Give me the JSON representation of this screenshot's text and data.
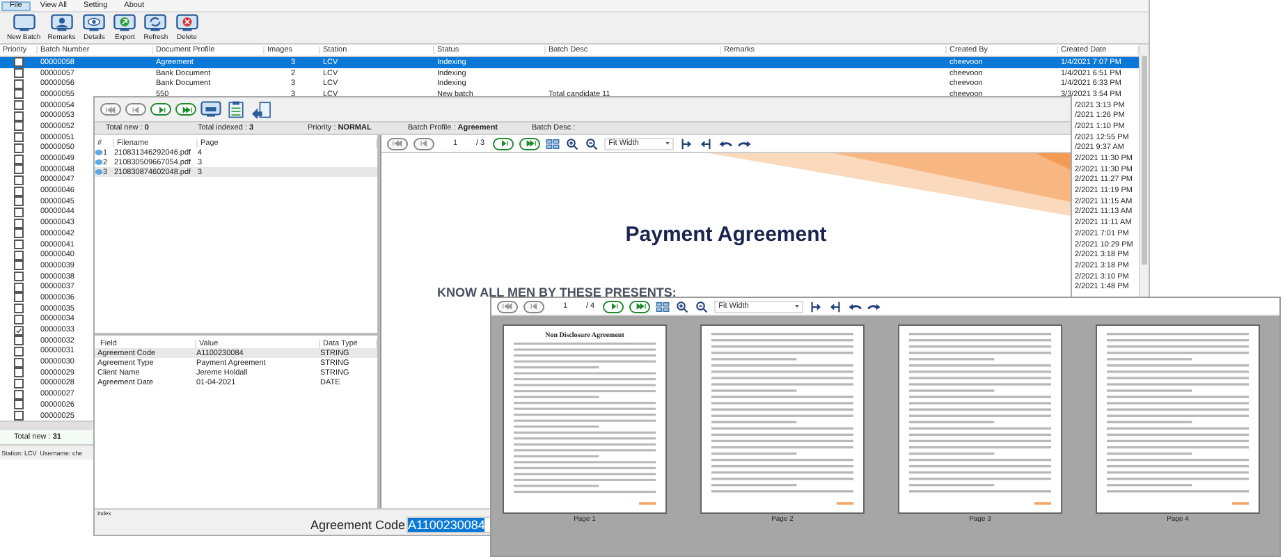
{
  "menu": [
    {
      "label": "File",
      "selected": true
    },
    {
      "label": "View All",
      "selected": false
    },
    {
      "label": "Setting",
      "selected": false
    },
    {
      "label": "About",
      "selected": false
    }
  ],
  "toolbar": [
    {
      "label": "New Batch",
      "kind": "new"
    },
    {
      "label": "Remarks",
      "kind": "remarks"
    },
    {
      "label": "Details",
      "kind": "details"
    },
    {
      "label": "Export",
      "kind": "export"
    },
    {
      "label": "Refresh",
      "kind": "refresh"
    },
    {
      "label": "Delete",
      "kind": "delete"
    }
  ],
  "batch_table": {
    "columns": [
      "Priority",
      "Batch Number",
      "Document Profile",
      "Images",
      "Station",
      "Status",
      "Batch Desc",
      "Remarks",
      "Created By",
      "Created Date"
    ],
    "rows": [
      {
        "kind": "full",
        "selected": true,
        "checked": false,
        "batch_number": "00000058",
        "document_profile": "Agreement",
        "images": "3",
        "station": "LCV",
        "status": "Indexing",
        "created_by": "cheevoon",
        "created_date": "1/4/2021 7:07 PM"
      },
      {
        "kind": "full",
        "selected": false,
        "checked": false,
        "batch_number": "00000057",
        "document_profile": "Bank Document",
        "images": "2",
        "station": "LCV",
        "status": "Indexing",
        "created_by": "cheevoon",
        "created_date": "1/4/2021 6:51 PM"
      },
      {
        "kind": "full",
        "selected": false,
        "checked": false,
        "batch_number": "00000056",
        "document_profile": "Bank Document",
        "images": "3",
        "station": "LCV",
        "status": "Indexing",
        "created_by": "cheevoon",
        "created_date": "1/4/2021 6:33 PM"
      },
      {
        "kind": "full",
        "selected": false,
        "checked": false,
        "batch_number": "00000055",
        "document_profile": "550",
        "images": "3",
        "station": "LCV",
        "status": "New batch",
        "batch_desc": "Total candidate 11",
        "created_by": "cheevoon",
        "created_date": "3/3/2021 3:54 PM"
      },
      {
        "kind": "covered",
        "selected": false,
        "checked": false,
        "batch_number": "00000054",
        "created_date": "/2021 3:13 PM"
      },
      {
        "kind": "covered",
        "selected": false,
        "checked": false,
        "batch_number": "00000053",
        "created_date": "/2021 1:26 PM"
      },
      {
        "kind": "covered",
        "selected": false,
        "checked": false,
        "batch_number": "00000052",
        "created_date": "/2021 1:10 PM"
      },
      {
        "kind": "covered",
        "selected": false,
        "checked": false,
        "batch_number": "00000051",
        "created_date": "/2021 12:55 PM"
      },
      {
        "kind": "covered",
        "selected": false,
        "checked": false,
        "batch_number": "00000050",
        "created_date": "/2021 9:37 AM"
      },
      {
        "kind": "covered",
        "selected": false,
        "checked": false,
        "batch_number": "00000049",
        "created_date": "2/2021 11:30 PM"
      },
      {
        "kind": "covered",
        "selected": false,
        "checked": false,
        "batch_number": "00000048",
        "created_date": "2/2021 11:30 PM"
      },
      {
        "kind": "covered",
        "selected": false,
        "checked": false,
        "batch_number": "00000047",
        "created_date": "2/2021 11:27 PM"
      },
      {
        "kind": "covered",
        "selected": false,
        "checked": false,
        "batch_number": "00000046",
        "created_date": "2/2021 11:19 PM"
      },
      {
        "kind": "covered",
        "selected": false,
        "checked": false,
        "batch_number": "00000045",
        "created_date": "2/2021 11:15 AM"
      },
      {
        "kind": "covered",
        "selected": false,
        "checked": false,
        "batch_number": "00000044",
        "created_date": "2/2021 11:13 AM"
      },
      {
        "kind": "covered",
        "selected": false,
        "checked": false,
        "batch_number": "00000043",
        "created_date": "2/2021 11:11 AM"
      },
      {
        "kind": "covered",
        "selected": false,
        "checked": false,
        "batch_number": "00000042",
        "created_date": "2/2021 7:01 PM"
      },
      {
        "kind": "covered",
        "selected": false,
        "checked": false,
        "batch_number": "00000041",
        "created_date": "2/2021 10:29 PM"
      },
      {
        "kind": "covered",
        "selected": false,
        "checked": false,
        "batch_number": "00000040",
        "created_date": "2/2021 3:18 PM"
      },
      {
        "kind": "covered",
        "selected": false,
        "checked": false,
        "batch_number": "00000039",
        "created_date": "2/2021 3:18 PM"
      },
      {
        "kind": "covered",
        "selected": false,
        "checked": false,
        "batch_number": "00000038",
        "created_date": "2/2021 3:10 PM"
      },
      {
        "kind": "covered",
        "selected": false,
        "checked": false,
        "batch_number": "00000037",
        "created_date": "2/2021 1:48 PM"
      },
      {
        "kind": "covered",
        "selected": false,
        "checked": false,
        "batch_number": "00000036"
      },
      {
        "kind": "covered",
        "selected": false,
        "checked": false,
        "batch_number": "00000035"
      },
      {
        "kind": "covered",
        "selected": false,
        "checked": false,
        "batch_number": "00000034"
      },
      {
        "kind": "covered",
        "selected": false,
        "checked": true,
        "batch_number": "00000033"
      },
      {
        "kind": "covered",
        "selected": false,
        "checked": false,
        "batch_number": "00000032"
      },
      {
        "kind": "covered",
        "selected": false,
        "checked": false,
        "batch_number": "00000031"
      },
      {
        "kind": "covered",
        "selected": false,
        "checked": false,
        "batch_number": "00000030"
      },
      {
        "kind": "covered",
        "selected": false,
        "checked": false,
        "batch_number": "00000029"
      },
      {
        "kind": "covered",
        "selected": false,
        "checked": false,
        "batch_number": "00000028"
      },
      {
        "kind": "covered",
        "selected": false,
        "checked": false,
        "batch_number": "00000027"
      },
      {
        "kind": "covered",
        "selected": false,
        "checked": false,
        "batch_number": "00000026"
      },
      {
        "kind": "covered",
        "selected": false,
        "checked": false,
        "batch_number": "00000025"
      }
    ]
  },
  "total_new": "Total new : **31**",
  "status_bar": "Station: LCV  Username: che",
  "index_window": {
    "nav_buttons": [
      {
        "kind": "first",
        "disabled": true
      },
      {
        "kind": "prev",
        "disabled": true
      },
      {
        "kind": "next",
        "disabled": false
      },
      {
        "kind": "last",
        "disabled": false
      }
    ],
    "info": [
      "Total new : **0**",
      "Total indexed : **3**",
      "Priority : **NORMAL**",
      "Batch Profile : **Agreement**",
      "Batch Desc :"
    ],
    "files": {
      "columns": [
        "#",
        "Filename",
        "Page"
      ],
      "rows": [
        {
          "number": "1",
          "filename": "210831346292046.pdf",
          "page": "4",
          "selected": false
        },
        {
          "number": "2",
          "filename": "210830509667054.pdf",
          "page": "3",
          "selected": false
        },
        {
          "number": "3",
          "filename": "210830874602048.pdf",
          "page": "3",
          "selected": true
        }
      ]
    },
    "fields": {
      "columns": [
        "Field",
        "Value",
        "Data Type"
      ],
      "rows": [
        {
          "field": "Agreement Code",
          "value": "A1100230084",
          "data_type": "STRING",
          "selected": true
        },
        {
          "field": "Agreement Type",
          "value": "Payment Agreement",
          "data_type": "STRING",
          "selected": false
        },
        {
          "field": "Client Name",
          "value": "Jereme Holdall",
          "data_type": "STRING",
          "selected": false
        },
        {
          "field": "Agreement Date",
          "value": "01-04-2021",
          "data_type": "DATE",
          "selected": false
        }
      ]
    },
    "viewer": {
      "nav_buttons": [
        {
          "kind": "first",
          "disabled": true
        },
        {
          "kind": "prev",
          "disabled": true
        },
        {
          "kind": "next",
          "disabled": false
        },
        {
          "kind": "last",
          "disabled": false
        }
      ],
      "page": "1",
      "page_total": "/ 3",
      "zoom": "Fit Width",
      "title": "Payment Agreement",
      "heading": "KNOW ALL MEN BY THESE PRESENTS:"
    },
    "index": {
      "group": "Index",
      "label": "Agreement Code",
      "value": "A1100230084"
    }
  },
  "thumbnail_window": {
    "viewer": {
      "nav_buttons": [
        {
          "kind": "first",
          "disabled": true
        },
        {
          "kind": "prev",
          "disabled": true
        },
        {
          "kind": "next",
          "disabled": false
        },
        {
          "kind": "last",
          "disabled": false
        }
      ],
      "page": "1",
      "page_total": "/ 4",
      "zoom": "Fit Width"
    },
    "pages": [
      {
        "title": "Non Disclosure Agreement",
        "label": "Page 1"
      },
      {
        "label": "Page 2"
      },
      {
        "label": "Page 3"
      },
      {
        "label": "Page 4"
      }
    ]
  }
}
